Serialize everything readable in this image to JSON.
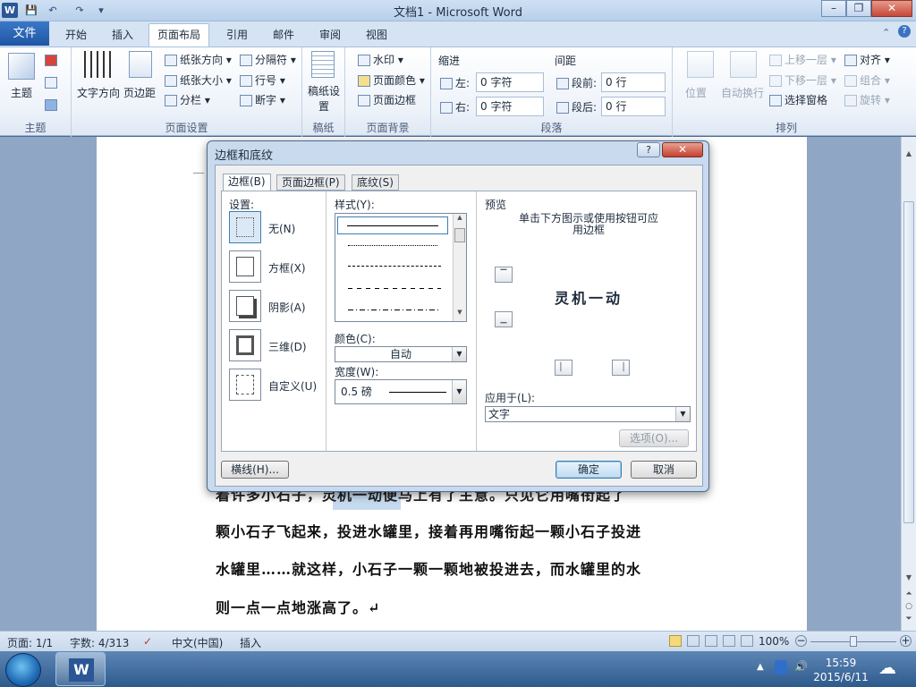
{
  "window": {
    "title": "文档1 - Microsoft Word",
    "min": "–",
    "max": "❐",
    "close": "✕"
  },
  "quick_access": {
    "save": "💾",
    "undo": "↶",
    "redo": "↷",
    "customize": "▾"
  },
  "tabs": [
    {
      "label": "文件"
    },
    {
      "label": "开始"
    },
    {
      "label": "插入"
    },
    {
      "label": "页面布局"
    },
    {
      "label": "引用"
    },
    {
      "label": "邮件"
    },
    {
      "label": "审阅"
    },
    {
      "label": "视图"
    }
  ],
  "ribbon": {
    "theme": {
      "label": "主题",
      "group": "主题"
    },
    "page_setup": {
      "text_direction": "文字方向",
      "margins": "页边距",
      "orientation": "纸张方向",
      "size": "纸张大小",
      "columns": "分栏",
      "breaks": "分隔符",
      "line_numbers": "行号",
      "hyphenation": "断字",
      "group": "页面设置"
    },
    "manuscript": {
      "label": "稿纸设置",
      "group": "稿纸"
    },
    "background": {
      "watermark": "水印",
      "page_color": "页面颜色",
      "page_borders": "页面边框",
      "group": "页面背景"
    },
    "paragraph": {
      "indent": "缩进",
      "left": "左:",
      "left_val": "0 字符",
      "right": "右:",
      "right_val": "0 字符",
      "spacing": "间距",
      "before": "段前:",
      "before_val": "0 行",
      "after": "段后:",
      "after_val": "0 行",
      "group": "段落"
    },
    "arrange": {
      "position": "位置",
      "wrap": "自动换行",
      "forward": "上移一层",
      "backward": "下移一层",
      "selection_pane": "选择窗格",
      "align": "对齐",
      "group_btn": "组合",
      "rotate": "旋转",
      "group": "排列"
    }
  },
  "document": {
    "lines": [
      "着许多小石子，灵机一动便马上有了主意。只见它用嘴衔起了",
      "颗小石子飞起来，投进水罐里，接着再用嘴衔起一颗小石子投进",
      "水罐里……就这样，小石子一颗一颗地被投进去，而水罐里的水",
      "则一点一点地涨高了。↵"
    ]
  },
  "dialog": {
    "title": "边框和底纹",
    "help": "?",
    "close": "✕",
    "tabs": [
      "边框(B)",
      "页面边框(P)",
      "底纹(S)"
    ],
    "setting_label": "设置:",
    "settings": [
      "无(N)",
      "方框(X)",
      "阴影(A)",
      "三维(D)",
      "自定义(U)"
    ],
    "style_label": "样式(Y):",
    "color_label": "颜色(C):",
    "color_value": "自动",
    "width_label": "宽度(W):",
    "width_value": "0.5 磅",
    "preview_label": "预览",
    "preview_hint": "单击下方图示或使用按钮可应用边框",
    "preview_text": "灵机一动",
    "apply_label": "应用于(L):",
    "apply_value": "文字",
    "options_btn": "选项(O)...",
    "hline_btn": "横线(H)...",
    "ok_btn": "确定",
    "cancel_btn": "取消"
  },
  "status": {
    "page": "页面: 1/1",
    "words": "字数: 4/313",
    "lang": "中文(中国)",
    "mode": "插入",
    "zoom": "100%"
  },
  "clock": {
    "time": "15:59",
    "date": "2015/6/11"
  }
}
